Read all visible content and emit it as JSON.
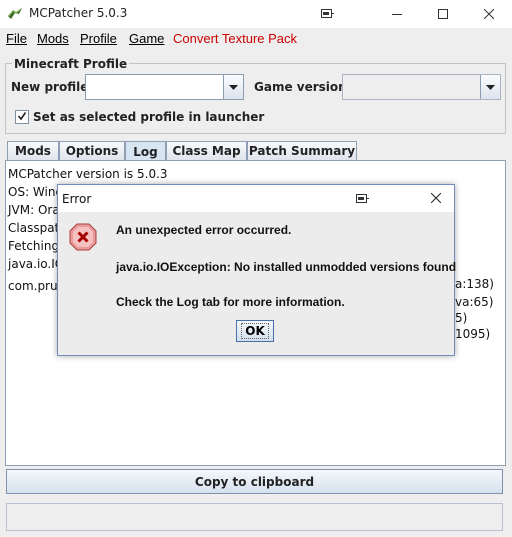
{
  "window": {
    "title": "MCPatcher 5.0.3"
  },
  "menu": {
    "file": "File",
    "mods": "Mods",
    "profile": "Profile",
    "game": "Game",
    "convert": "Convert Texture Pack",
    "convert_color": "#cc0000"
  },
  "profile": {
    "legend": "Minecraft Profile",
    "new_profile_label": "New profile",
    "new_profile_value": "",
    "game_version_label": "Game version",
    "game_version_value": "",
    "checkbox_label": "Set as selected profile in launcher",
    "checkbox_checked": true
  },
  "tabs": [
    "Mods",
    "Options",
    "Log",
    "Class Map",
    "Patch Summary"
  ],
  "active_tab": "Log",
  "log": {
    "lines": [
      "MCPatcher version is 5.0.3",
      "OS: Wind",
      "JVM: Ora",
      "Classpat",
      "Fetching",
      "java.io.IO",
      "",
      "com.prup"
    ],
    "right_fragments": [
      "a:138)",
      "va:65)",
      "5)",
      "1095)"
    ]
  },
  "copy_button": "Copy to clipboard",
  "dialog": {
    "title": "Error",
    "line1": "An unexpected error occurred.",
    "line2": "java.io.IOException: No installed unmodded versions found",
    "line3": "Check the Log tab for more information.",
    "ok": "OK"
  }
}
